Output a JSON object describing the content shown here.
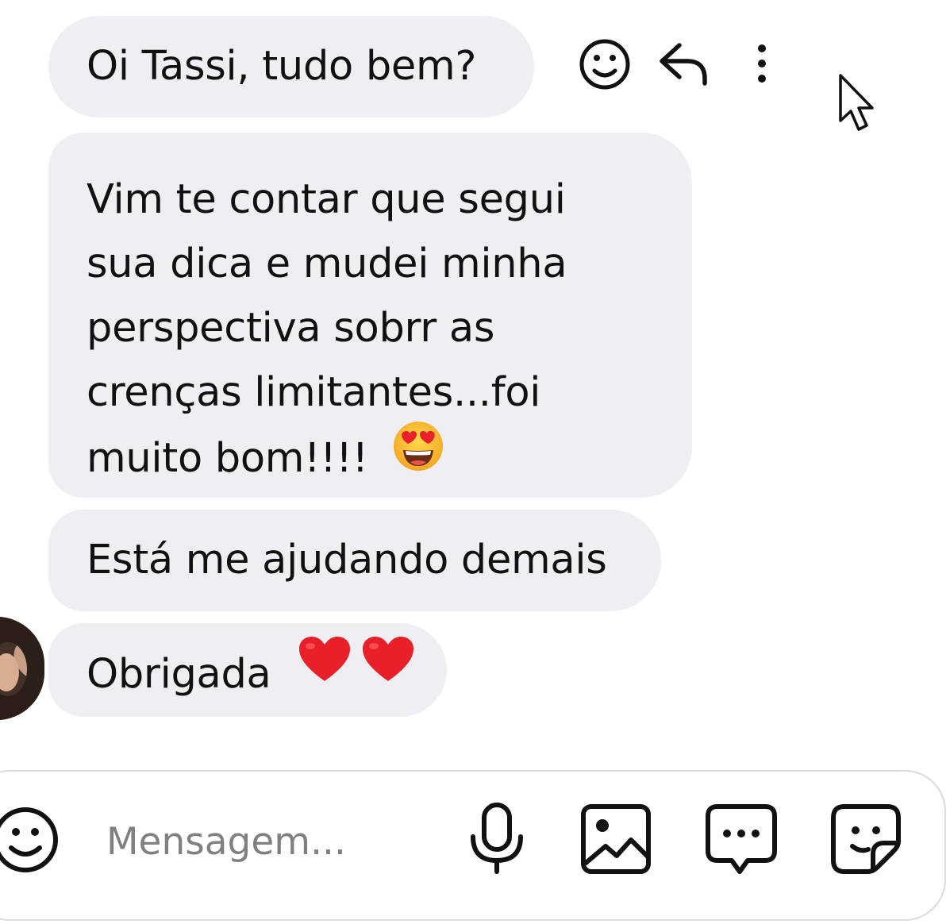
{
  "messages": [
    {
      "text": "Oi Tassi, tudo bem?"
    },
    {
      "lines": [
        "Vim te contar que segui",
        "sua dica e mudei minha",
        "perspectiva sobrr as",
        "crenças limitantes...foi",
        "muito bom!!!!"
      ],
      "emoji": "smiling-face-with-heart-eyes"
    },
    {
      "text": "Está me ajudando demais"
    },
    {
      "text": "Obrigada",
      "emoji": [
        "red-heart",
        "red-heart"
      ]
    }
  ],
  "message_actions": {
    "icons": [
      "smiley-react-icon",
      "reply-icon",
      "more-options-icon"
    ]
  },
  "composer": {
    "placeholder": "Mensagem...",
    "icons": [
      "emoji-icon",
      "microphone-icon",
      "image-icon",
      "chat-bubble-icon",
      "sticker-icon"
    ]
  },
  "colors": {
    "bubble_bg": "#efeff3",
    "text": "#111111",
    "placeholder": "#808080",
    "heart": "#e8202a",
    "composer_border": "#dbdbdb"
  }
}
